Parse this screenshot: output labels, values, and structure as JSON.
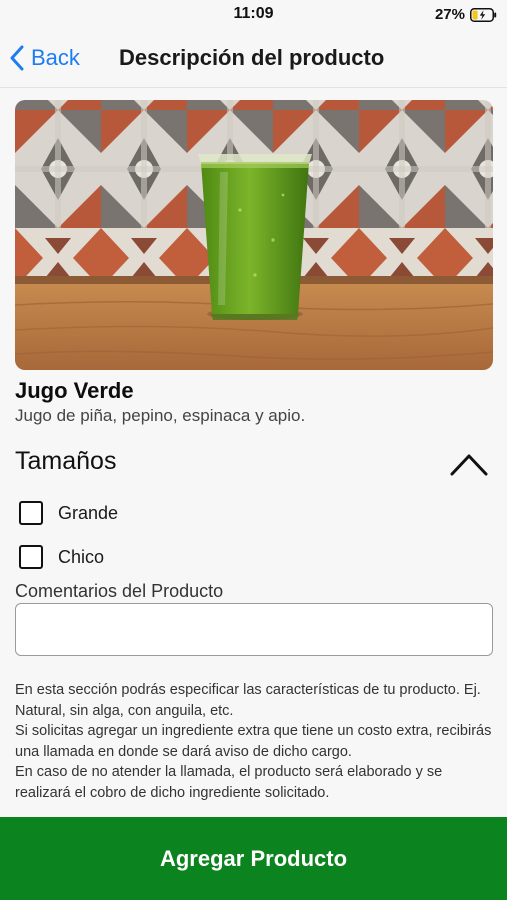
{
  "status_bar": {
    "time": "11:09",
    "battery_percent": "27%",
    "battery_level": 0.27,
    "charging": true
  },
  "nav": {
    "back_label": "Back",
    "back_icon": "chevron-left-icon",
    "title": "Descripción del producto"
  },
  "product": {
    "image_icon": "green-juice-photo",
    "name": "Jugo Verde",
    "description": "Jugo de piña, pepino, espinaca y apio."
  },
  "sizes": {
    "header": "Tamaños",
    "toggle_icon": "chevron-up-icon",
    "options": [
      {
        "label": "Grande",
        "checked": false
      },
      {
        "label": "Chico",
        "checked": false
      }
    ]
  },
  "comments": {
    "label": "Comentarios del Producto",
    "value": "",
    "placeholder": ""
  },
  "help": [
    "En esta sección podrás especificar las características de tu producto. Ej. Natural, sin alga, con anguila, etc.",
    "Si solicitas agregar un ingrediente extra que tiene un costo extra, recibirás una llamada en donde se dará aviso de dicho cargo.",
    "En caso de no atender la llamada, el producto será elaborado y se realizará el cobro de dicho ingrediente solicitado."
  ],
  "footer": {
    "add_label": "Agregar Producto"
  },
  "colors": {
    "accent": "#1e7cf2",
    "primary_button": "#0b831e",
    "battery_charging": "#f5c518"
  }
}
